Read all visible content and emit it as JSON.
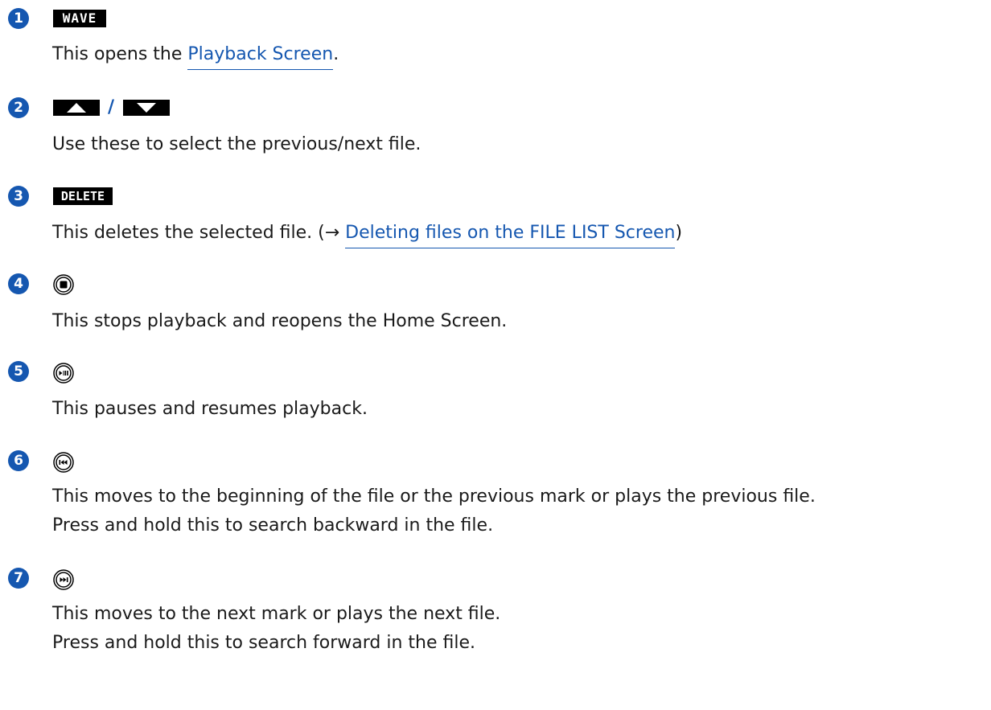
{
  "items": [
    {
      "number": "1",
      "badge": "WAVE",
      "text_before": "This opens the ",
      "link": "Playback Screen",
      "text_after": "."
    },
    {
      "number": "2",
      "separator": "/",
      "text": "Use these to select the previous/next file."
    },
    {
      "number": "3",
      "badge": "DELETE",
      "text_before": "This deletes the selected file. (→ ",
      "link": "Deleting files on the FILE LIST Screen",
      "text_after": ")"
    },
    {
      "number": "4",
      "icon": "stop-button-icon",
      "text": "This stops playback and reopens the Home Screen."
    },
    {
      "number": "5",
      "icon": "play-pause-button-icon",
      "text": "This pauses and resumes playback."
    },
    {
      "number": "6",
      "icon": "rewind-button-icon",
      "lines": [
        "This moves to the beginning of the file or the previous mark or plays the previous file.",
        "Press and hold this to search backward in the file."
      ]
    },
    {
      "number": "7",
      "icon": "fast-forward-button-icon",
      "lines": [
        "This moves to the next mark or plays the next file.",
        "Press and hold this to search forward in the file."
      ]
    }
  ],
  "colors": {
    "accent": "#1557b0",
    "text": "#1a1a1a",
    "badge_bg": "#000000"
  }
}
